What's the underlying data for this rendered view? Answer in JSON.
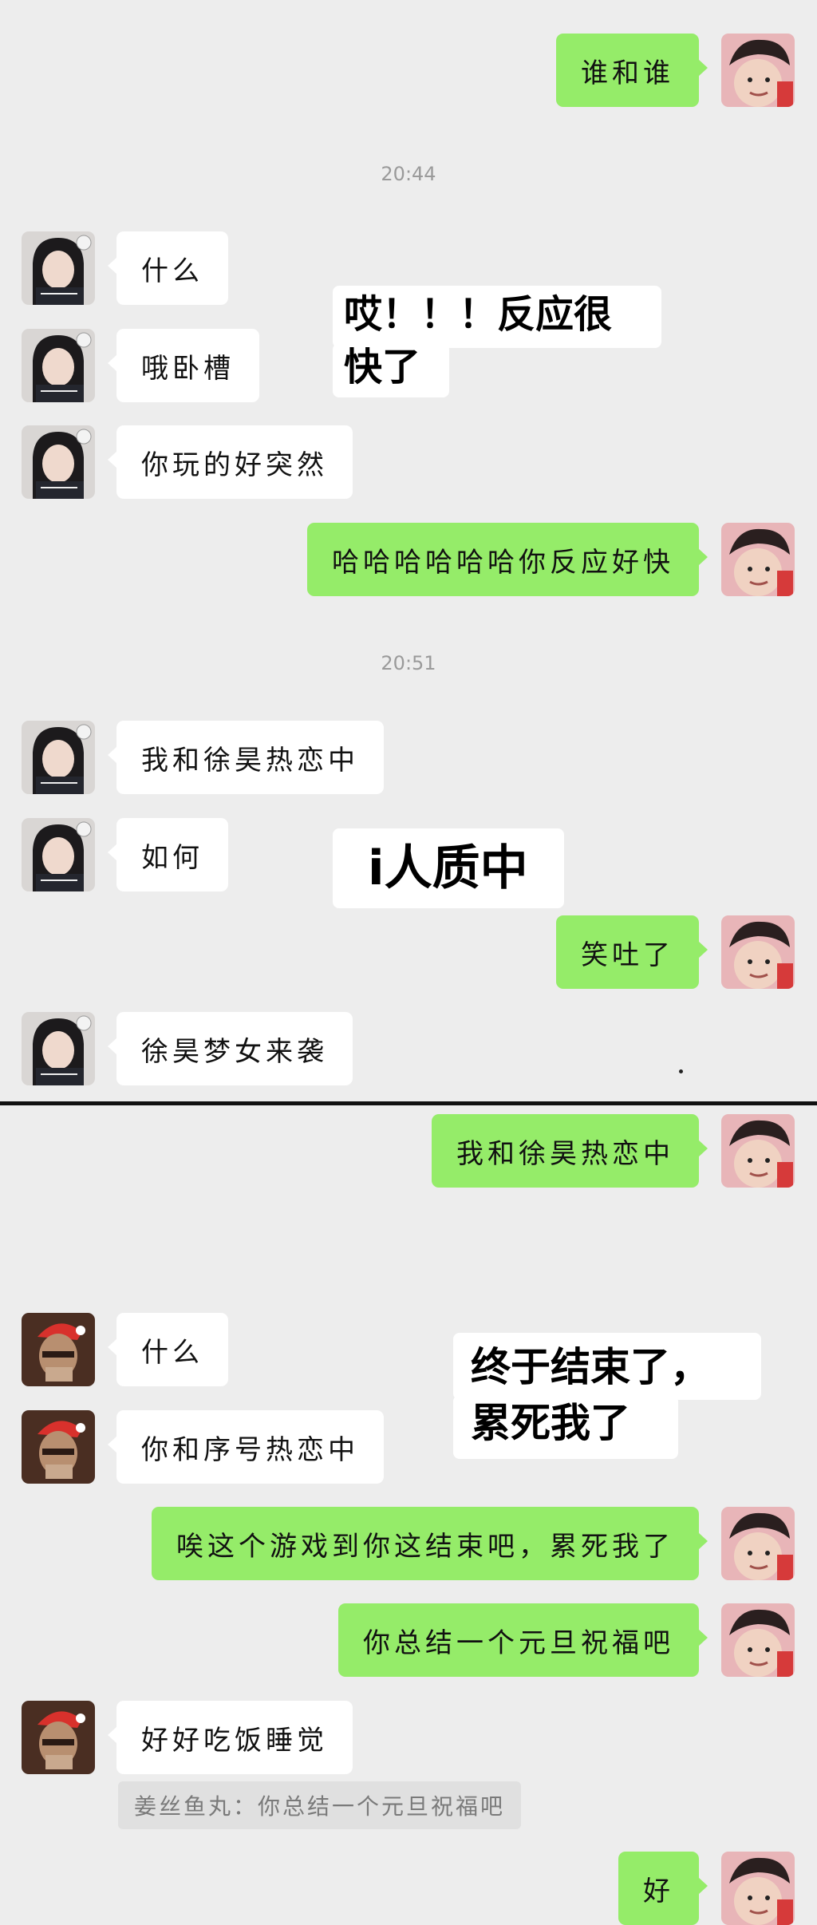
{
  "messages": {
    "m1": "谁和谁",
    "t1": "20:44",
    "m2": "什么",
    "m3": "哦卧槽",
    "m4": "你玩的好突然",
    "m5": "哈哈哈哈哈哈你反应好快",
    "t2": "20:51",
    "m6": "我和徐昊热恋中",
    "m7": "如何",
    "m8": "笑吐了",
    "m9": "徐昊梦女来袭",
    "m10": "我和徐昊热恋中",
    "m11": "什么",
    "m12": "你和序号热恋中",
    "m13": "唉这个游戏到你这结束吧，累死我了",
    "m14": "你总结一个元旦祝福吧",
    "m15": "好好吃饭睡觉",
    "quote": "姜丝鱼丸：你总结一个元旦祝福吧",
    "m16": "好"
  },
  "captions": {
    "c1_line1": "哎！！！反应很",
    "c1_line2": "快了",
    "c2": "i人质中",
    "c3_line1": "终于结束了，",
    "c3_line2": "累死我了"
  },
  "colors": {
    "sent_bubble": "#95ec69",
    "received_bubble": "#ffffff",
    "background": "#ededed"
  }
}
